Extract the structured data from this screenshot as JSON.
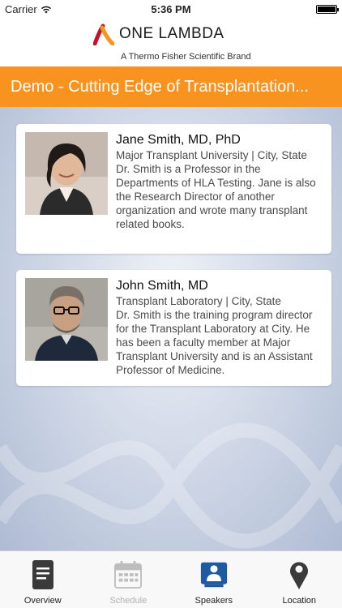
{
  "status": {
    "carrier": "Carrier",
    "time": "5:36 PM"
  },
  "brand": {
    "name": "ONE LAMBDA",
    "tagline": "A Thermo Fisher Scientific Brand"
  },
  "title": "Demo - Cutting Edge of Transplantation...",
  "speakers": [
    {
      "name": "Jane Smith, MD, PhD",
      "affiliation": "Major Transplant University | City, State",
      "bio": "Dr. Smith is a Professor in the Departments of HLA Testing. Jane is also the Research Director of another organization and wrote many transplant related books."
    },
    {
      "name": "John Smith, MD",
      "affiliation": "Transplant Laboratory | City, State",
      "bio": "Dr. Smith is the training program director for the Transplant Laboratory at City. He has been a faculty member at Major Transplant University and is an Assistant Professor of Medicine."
    }
  ],
  "tabs": [
    {
      "label": "Overview",
      "icon": "document-icon",
      "state": "normal"
    },
    {
      "label": "Schedule",
      "icon": "calendar-icon",
      "state": "disabled"
    },
    {
      "label": "Speakers",
      "icon": "speaker-icon",
      "state": "selected"
    },
    {
      "label": "Location",
      "icon": "location-pin-icon",
      "state": "normal"
    }
  ],
  "colors": {
    "brand_orange": "#f7931e",
    "selected_blue": "#1e5aa0",
    "brand_red": "#c8102e"
  }
}
